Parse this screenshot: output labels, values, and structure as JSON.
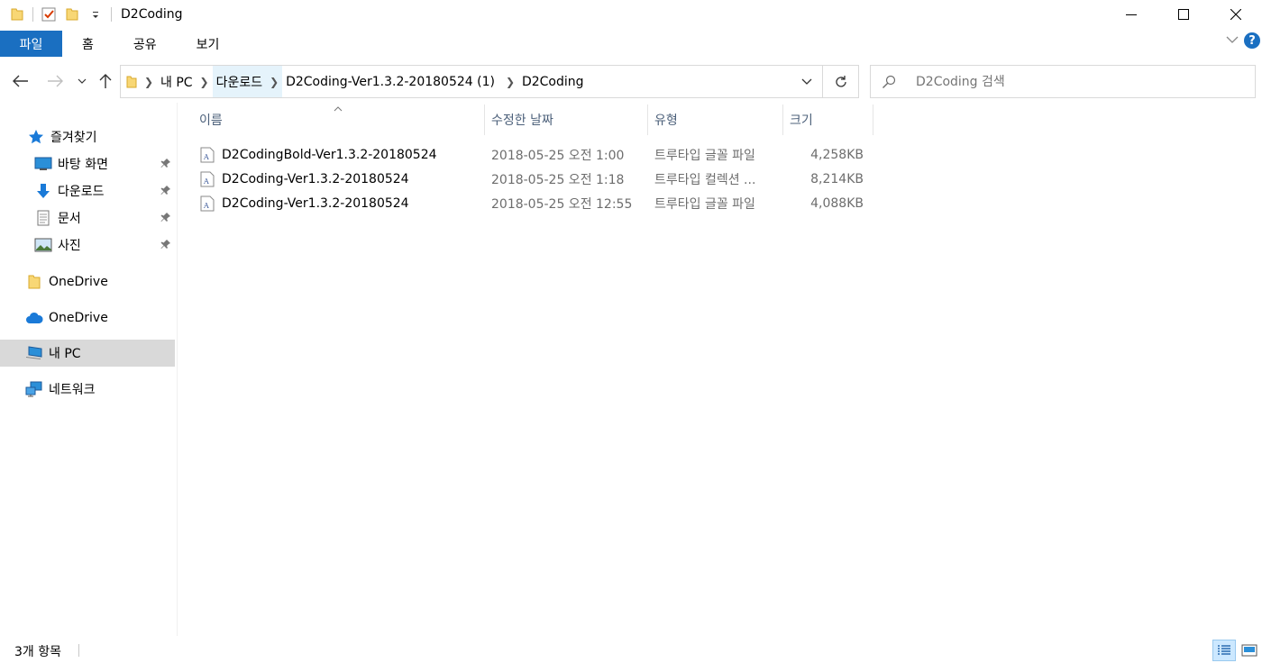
{
  "window": {
    "title": "D2Coding"
  },
  "ribbon": {
    "file": "파일",
    "tabs": [
      "홈",
      "공유",
      "보기"
    ],
    "help": "?"
  },
  "address": {
    "crumbs": [
      "내 PC",
      "다운로드",
      "D2Coding-Ver1.3.2-20180524 (1)",
      "D2Coding"
    ],
    "active_crumb_index": 1
  },
  "search": {
    "placeholder": "D2Coding 검색"
  },
  "nav": {
    "quick_access": "즐겨찾기",
    "pinned": [
      {
        "label": "바탕 화면",
        "icon": "desktop-icon"
      },
      {
        "label": "다운로드",
        "icon": "download-arrow-icon"
      },
      {
        "label": "문서",
        "icon": "document-icon"
      },
      {
        "label": "사진",
        "icon": "pictures-icon"
      }
    ],
    "onedrive_folder": "OneDrive",
    "onedrive_cloud": "OneDrive",
    "this_pc": "내 PC",
    "network": "네트워크"
  },
  "columns": {
    "name": "이름",
    "date": "수정한 날짜",
    "type": "유형",
    "size": "크기"
  },
  "files": [
    {
      "name": "D2CodingBold-Ver1.3.2-20180524",
      "date": "2018-05-25 오전 1:00",
      "type": "트루타입 글꼴 파일",
      "size": "4,258KB"
    },
    {
      "name": "D2Coding-Ver1.3.2-20180524",
      "date": "2018-05-25 오전 1:18",
      "type": "트루타입 컬렉션 ...",
      "size": "8,214KB"
    },
    {
      "name": "D2Coding-Ver1.3.2-20180524",
      "date": "2018-05-25 오전 12:55",
      "type": "트루타입 글꼴 파일",
      "size": "4,088KB"
    }
  ],
  "status": {
    "count": "3개 항목"
  },
  "colors": {
    "accent": "#1a6fc1",
    "selection": "#d9d9d9",
    "header_text": "#4c607a"
  }
}
